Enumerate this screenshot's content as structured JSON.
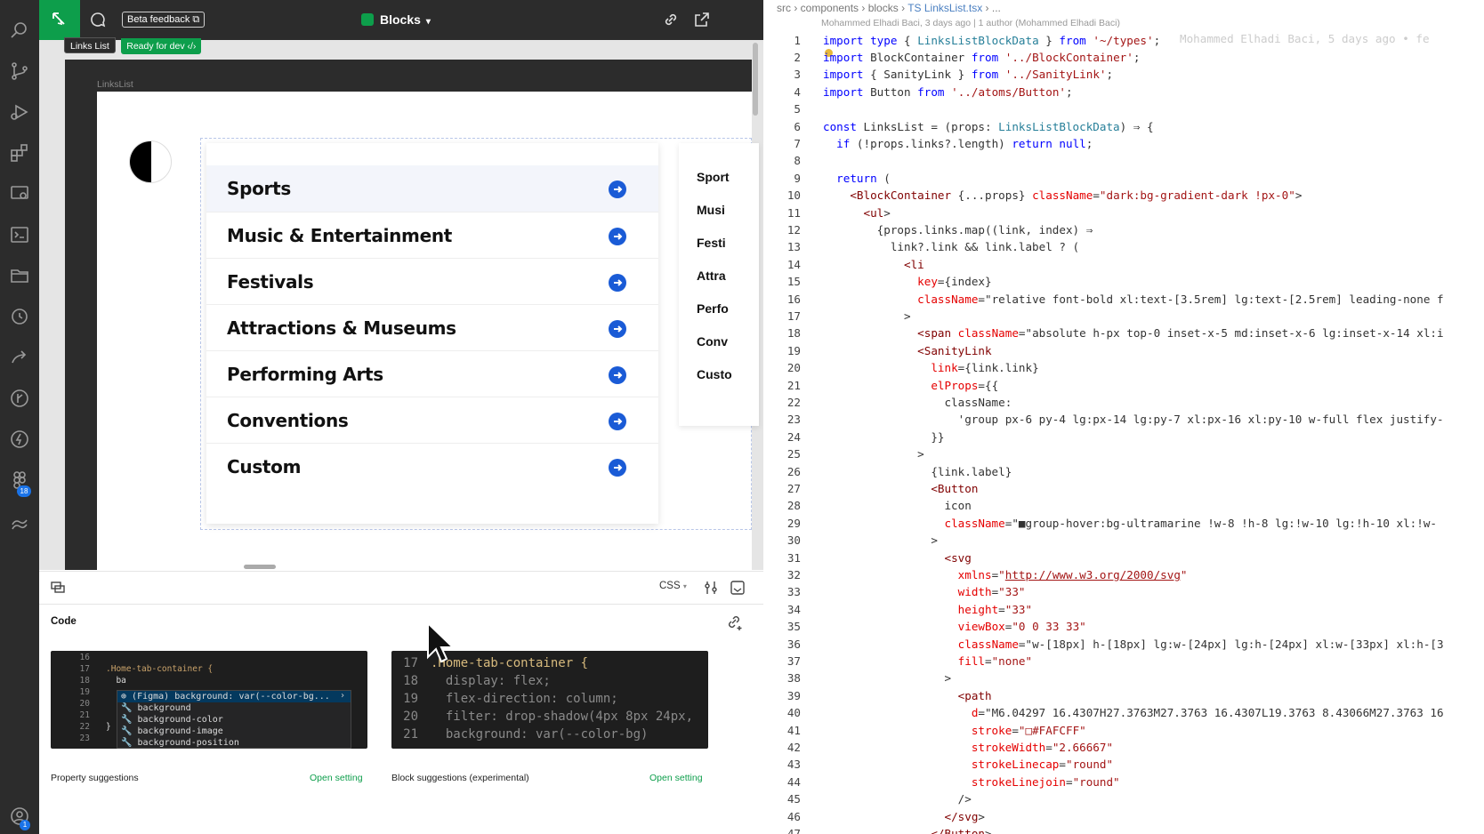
{
  "figma": {
    "beta_label": "Beta feedback ⧉",
    "file_title": "Blocks",
    "frame_tag": "Links List",
    "status_tag": "Ready for dev ‹/›",
    "frame_label": "LinksList",
    "links": [
      "Sports",
      "Music & Entertainment",
      "Festivals",
      "Attractions & Museums",
      "Performing Arts",
      "Conventions",
      "Custom"
    ],
    "mini_links": [
      "Sport",
      "Musi",
      "Festi",
      "Attra",
      "Perfo",
      "Conv",
      "Custo"
    ],
    "panel": {
      "lang": "CSS",
      "section_title": "Code",
      "left_caption": "Property suggestions",
      "right_caption": "Block suggestions (experimental)",
      "open_setting": "Open setting"
    },
    "left_code": {
      "lines": [
        {
          "n": "16",
          "code": ""
        },
        {
          "n": "17",
          "code": ".Home-tab-container {"
        },
        {
          "n": "18",
          "code": "  ba"
        },
        {
          "n": "19",
          "code": ""
        },
        {
          "n": "20",
          "code": ""
        },
        {
          "n": "21",
          "code": ""
        },
        {
          "n": "22",
          "code": "}"
        },
        {
          "n": "23",
          "code": ""
        }
      ],
      "suggestions": [
        "(Figma) background: var(--color-bg...",
        "background",
        "background-color",
        "background-image",
        "background-position"
      ]
    },
    "right_code": [
      {
        "n": "17",
        "code": ".Home-tab-container {"
      },
      {
        "n": "18",
        "code": "  display: flex;"
      },
      {
        "n": "19",
        "code": "  flex-direction: column;"
      },
      {
        "n": "20",
        "code": "  filter: drop-shadow(4px 8px 24px,"
      },
      {
        "n": "21",
        "code": "  background: var(--color-bg)"
      }
    ]
  },
  "editor": {
    "breadcrumb": [
      "src",
      "components",
      "blocks",
      "TS LinksList.tsx",
      "..."
    ],
    "blame_header": "Mohammed Elhadi Baci, 3 days ago | 1 author (Mohammed Elhadi Baci)",
    "inline_blame": "Mohammed Elhadi Baci, 5 days ago • fe",
    "lines": [
      "import type { LinksListBlockData } from '~/types';",
      "import BlockContainer from '../BlockContainer';",
      "import { SanityLink } from '../SanityLink';",
      "import Button from '../atoms/Button';",
      "",
      "const LinksList = (props: LinksListBlockData) ⇒ {",
      "  if (!props.links?.length) return null;",
      "",
      "  return (",
      "    <BlockContainer {...props} className=\"dark:bg-gradient-dark !px-0\">",
      "      <ul>",
      "        {props.links.map((link, index) ⇒",
      "          link?.link && link.label ? (",
      "            <li",
      "              key={index}",
      "              className=\"relative font-bold xl:text-[3.5rem] lg:text-[2.5rem] leading-none f",
      "            >",
      "              <span className=\"absolute h-px top-0 inset-x-5 md:inset-x-6 lg:inset-x-14 xl:i",
      "              <SanityLink",
      "                link={link.link}",
      "                elProps={{",
      "                  className:",
      "                    'group px-6 py-4 lg:px-14 lg:py-7 xl:px-16 xl:py-10 w-full flex justify-",
      "                }}",
      "              >",
      "                {link.label}",
      "                <Button",
      "                  icon",
      "                  className=\"■group-hover:bg-ultramarine !w-8 !h-8 lg:!w-10 lg:!h-10 xl:!w-",
      "                >",
      "                  <svg",
      "                    xmlns=\"http://www.w3.org/2000/svg\"",
      "                    width=\"33\"",
      "                    height=\"33\"",
      "                    viewBox=\"0 0 33 33\"",
      "                    className=\"w-[18px] h-[18px] lg:w-[24px] lg:h-[24px] xl:w-[33px] xl:h-[3",
      "                    fill=\"none\"",
      "                  >",
      "                    <path",
      "                      d=\"M6.04297 16.4307H27.3763M27.3763 16.4307L19.3763 8.43066M27.3763 16",
      "                      stroke=\"□#FAFCFF\"",
      "                      strokeWidth=\"2.66667\"",
      "                      strokeLinecap=\"round\"",
      "                      strokeLinejoin=\"round\"",
      "                    />",
      "                  </svg>",
      "                </Button>"
    ]
  },
  "activity_badges": {
    "extensions": "18",
    "account": "1"
  },
  "colors": {
    "figma_green": "#0d9e4b",
    "link_arrow_blue": "#1a5bd6",
    "dark_chrome": "#2c2c2c"
  }
}
